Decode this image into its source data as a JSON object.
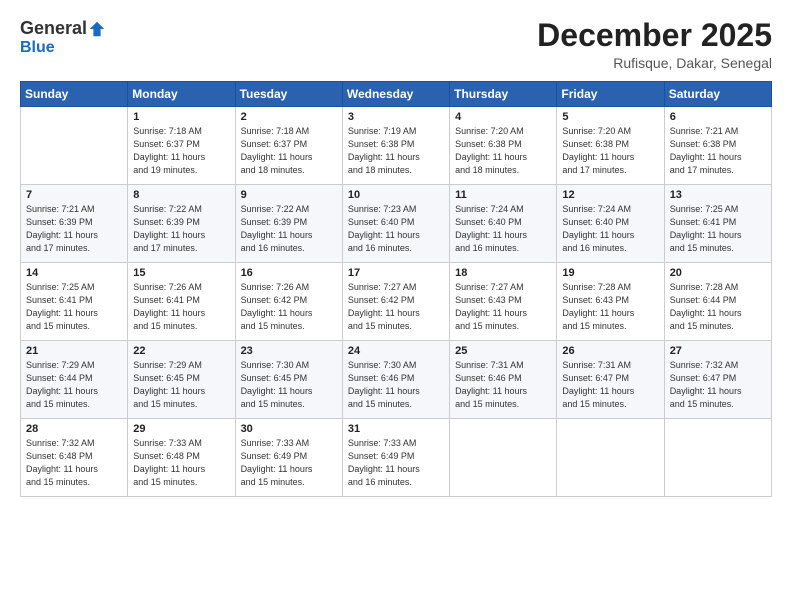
{
  "logo": {
    "general": "General",
    "blue": "Blue"
  },
  "header": {
    "month": "December 2025",
    "location": "Rufisque, Dakar, Senegal"
  },
  "days_of_week": [
    "Sunday",
    "Monday",
    "Tuesday",
    "Wednesday",
    "Thursday",
    "Friday",
    "Saturday"
  ],
  "weeks": [
    [
      {
        "day": "",
        "sunrise": "",
        "sunset": "",
        "daylight": ""
      },
      {
        "day": "1",
        "sunrise": "Sunrise: 7:18 AM",
        "sunset": "Sunset: 6:37 PM",
        "daylight": "Daylight: 11 hours and 19 minutes."
      },
      {
        "day": "2",
        "sunrise": "Sunrise: 7:18 AM",
        "sunset": "Sunset: 6:37 PM",
        "daylight": "Daylight: 11 hours and 18 minutes."
      },
      {
        "day": "3",
        "sunrise": "Sunrise: 7:19 AM",
        "sunset": "Sunset: 6:38 PM",
        "daylight": "Daylight: 11 hours and 18 minutes."
      },
      {
        "day": "4",
        "sunrise": "Sunrise: 7:20 AM",
        "sunset": "Sunset: 6:38 PM",
        "daylight": "Daylight: 11 hours and 18 minutes."
      },
      {
        "day": "5",
        "sunrise": "Sunrise: 7:20 AM",
        "sunset": "Sunset: 6:38 PM",
        "daylight": "Daylight: 11 hours and 17 minutes."
      },
      {
        "day": "6",
        "sunrise": "Sunrise: 7:21 AM",
        "sunset": "Sunset: 6:38 PM",
        "daylight": "Daylight: 11 hours and 17 minutes."
      }
    ],
    [
      {
        "day": "7",
        "sunrise": "Sunrise: 7:21 AM",
        "sunset": "Sunset: 6:39 PM",
        "daylight": "Daylight: 11 hours and 17 minutes."
      },
      {
        "day": "8",
        "sunrise": "Sunrise: 7:22 AM",
        "sunset": "Sunset: 6:39 PM",
        "daylight": "Daylight: 11 hours and 17 minutes."
      },
      {
        "day": "9",
        "sunrise": "Sunrise: 7:22 AM",
        "sunset": "Sunset: 6:39 PM",
        "daylight": "Daylight: 11 hours and 16 minutes."
      },
      {
        "day": "10",
        "sunrise": "Sunrise: 7:23 AM",
        "sunset": "Sunset: 6:40 PM",
        "daylight": "Daylight: 11 hours and 16 minutes."
      },
      {
        "day": "11",
        "sunrise": "Sunrise: 7:24 AM",
        "sunset": "Sunset: 6:40 PM",
        "daylight": "Daylight: 11 hours and 16 minutes."
      },
      {
        "day": "12",
        "sunrise": "Sunrise: 7:24 AM",
        "sunset": "Sunset: 6:40 PM",
        "daylight": "Daylight: 11 hours and 16 minutes."
      },
      {
        "day": "13",
        "sunrise": "Sunrise: 7:25 AM",
        "sunset": "Sunset: 6:41 PM",
        "daylight": "Daylight: 11 hours and 15 minutes."
      }
    ],
    [
      {
        "day": "14",
        "sunrise": "Sunrise: 7:25 AM",
        "sunset": "Sunset: 6:41 PM",
        "daylight": "Daylight: 11 hours and 15 minutes."
      },
      {
        "day": "15",
        "sunrise": "Sunrise: 7:26 AM",
        "sunset": "Sunset: 6:41 PM",
        "daylight": "Daylight: 11 hours and 15 minutes."
      },
      {
        "day": "16",
        "sunrise": "Sunrise: 7:26 AM",
        "sunset": "Sunset: 6:42 PM",
        "daylight": "Daylight: 11 hours and 15 minutes."
      },
      {
        "day": "17",
        "sunrise": "Sunrise: 7:27 AM",
        "sunset": "Sunset: 6:42 PM",
        "daylight": "Daylight: 11 hours and 15 minutes."
      },
      {
        "day": "18",
        "sunrise": "Sunrise: 7:27 AM",
        "sunset": "Sunset: 6:43 PM",
        "daylight": "Daylight: 11 hours and 15 minutes."
      },
      {
        "day": "19",
        "sunrise": "Sunrise: 7:28 AM",
        "sunset": "Sunset: 6:43 PM",
        "daylight": "Daylight: 11 hours and 15 minutes."
      },
      {
        "day": "20",
        "sunrise": "Sunrise: 7:28 AM",
        "sunset": "Sunset: 6:44 PM",
        "daylight": "Daylight: 11 hours and 15 minutes."
      }
    ],
    [
      {
        "day": "21",
        "sunrise": "Sunrise: 7:29 AM",
        "sunset": "Sunset: 6:44 PM",
        "daylight": "Daylight: 11 hours and 15 minutes."
      },
      {
        "day": "22",
        "sunrise": "Sunrise: 7:29 AM",
        "sunset": "Sunset: 6:45 PM",
        "daylight": "Daylight: 11 hours and 15 minutes."
      },
      {
        "day": "23",
        "sunrise": "Sunrise: 7:30 AM",
        "sunset": "Sunset: 6:45 PM",
        "daylight": "Daylight: 11 hours and 15 minutes."
      },
      {
        "day": "24",
        "sunrise": "Sunrise: 7:30 AM",
        "sunset": "Sunset: 6:46 PM",
        "daylight": "Daylight: 11 hours and 15 minutes."
      },
      {
        "day": "25",
        "sunrise": "Sunrise: 7:31 AM",
        "sunset": "Sunset: 6:46 PM",
        "daylight": "Daylight: 11 hours and 15 minutes."
      },
      {
        "day": "26",
        "sunrise": "Sunrise: 7:31 AM",
        "sunset": "Sunset: 6:47 PM",
        "daylight": "Daylight: 11 hours and 15 minutes."
      },
      {
        "day": "27",
        "sunrise": "Sunrise: 7:32 AM",
        "sunset": "Sunset: 6:47 PM",
        "daylight": "Daylight: 11 hours and 15 minutes."
      }
    ],
    [
      {
        "day": "28",
        "sunrise": "Sunrise: 7:32 AM",
        "sunset": "Sunset: 6:48 PM",
        "daylight": "Daylight: 11 hours and 15 minutes."
      },
      {
        "day": "29",
        "sunrise": "Sunrise: 7:33 AM",
        "sunset": "Sunset: 6:48 PM",
        "daylight": "Daylight: 11 hours and 15 minutes."
      },
      {
        "day": "30",
        "sunrise": "Sunrise: 7:33 AM",
        "sunset": "Sunset: 6:49 PM",
        "daylight": "Daylight: 11 hours and 15 minutes."
      },
      {
        "day": "31",
        "sunrise": "Sunrise: 7:33 AM",
        "sunset": "Sunset: 6:49 PM",
        "daylight": "Daylight: 11 hours and 16 minutes."
      },
      {
        "day": "",
        "sunrise": "",
        "sunset": "",
        "daylight": ""
      },
      {
        "day": "",
        "sunrise": "",
        "sunset": "",
        "daylight": ""
      },
      {
        "day": "",
        "sunrise": "",
        "sunset": "",
        "daylight": ""
      }
    ]
  ]
}
